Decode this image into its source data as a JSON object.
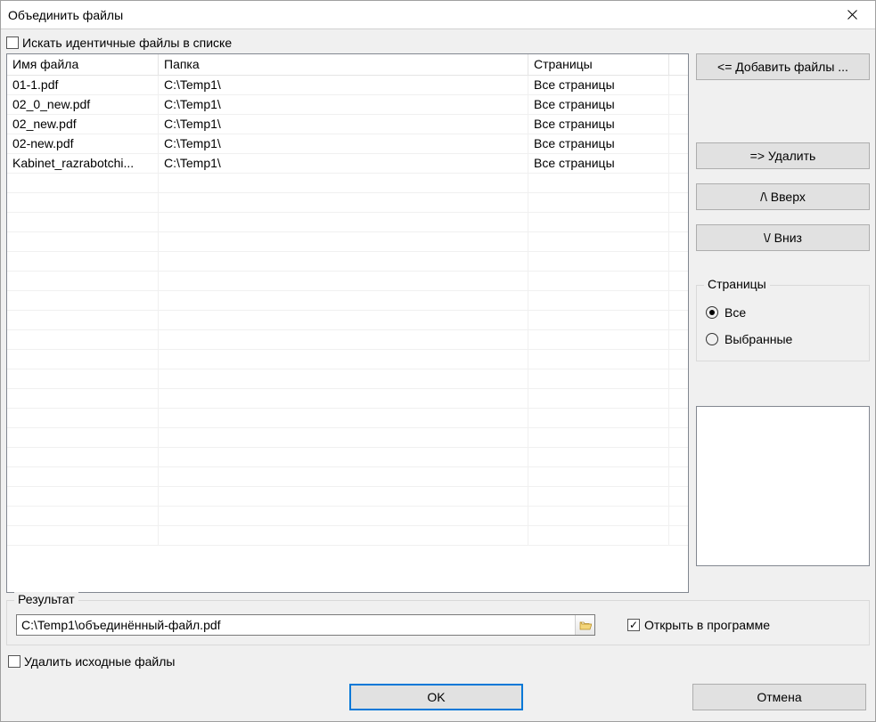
{
  "window": {
    "title": "Объединить файлы"
  },
  "identical_checkbox": {
    "label": "Искать идентичные файлы в списке",
    "checked": false
  },
  "table": {
    "headers": {
      "file": "Имя файла",
      "folder": "Папка",
      "pages": "Страницы"
    },
    "rows": [
      {
        "file": "01-1.pdf",
        "folder": "C:\\Temp1\\",
        "pages": "Все страницы"
      },
      {
        "file": "02_0_new.pdf",
        "folder": "C:\\Temp1\\",
        "pages": "Все страницы"
      },
      {
        "file": "02_new.pdf",
        "folder": "C:\\Temp1\\",
        "pages": "Все страницы"
      },
      {
        "file": "02-new.pdf",
        "folder": "C:\\Temp1\\",
        "pages": "Все страницы"
      },
      {
        "file": "Kabinet_razrabotchi...",
        "folder": "C:\\Temp1\\",
        "pages": "Все страницы"
      }
    ]
  },
  "side_buttons": {
    "add": "<= Добавить файлы ...",
    "remove": "=> Удалить",
    "up": "/\\  Вверх",
    "down": "\\/  Вниз"
  },
  "pages_group": {
    "legend": "Страницы",
    "all": "Все",
    "selected": "Выбранные",
    "choice": "all"
  },
  "result_group": {
    "legend": "Результат",
    "path": "C:\\Temp1\\объединённый-файл.pdf",
    "open_in_program": {
      "label": "Открыть в программе",
      "checked": true
    }
  },
  "delete_source": {
    "label": "Удалить исходные файлы",
    "checked": false
  },
  "footer": {
    "ok": "OK",
    "cancel": "Отмена"
  }
}
